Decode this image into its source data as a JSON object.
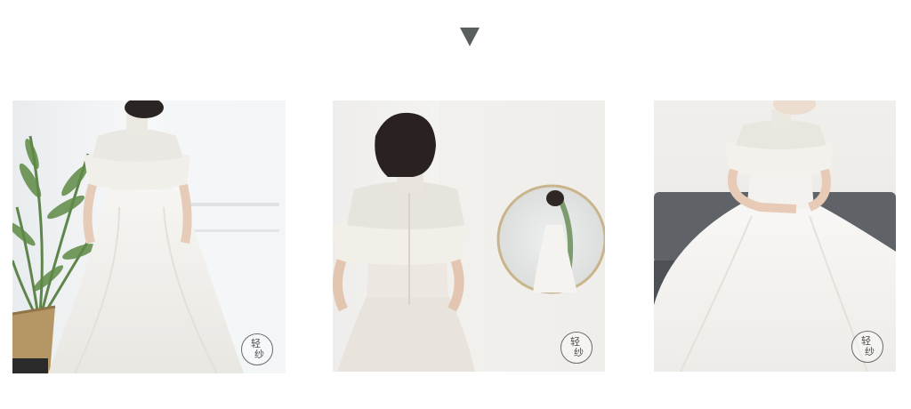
{
  "indicator": {
    "icon": "down-triangle-icon",
    "color": "#5a5e5e"
  },
  "gallery": {
    "photos": [
      {
        "subject": "wedding-dress-back-view-with-palm-plant",
        "watermark_line1": "轻",
        "watermark_line2": "纱"
      },
      {
        "subject": "wedding-dress-back-view-with-round-mirror",
        "watermark_line1": "轻",
        "watermark_line2": "纱"
      },
      {
        "subject": "wedding-dress-front-view-on-sofa",
        "watermark_line1": "轻",
        "watermark_line2": "纱"
      }
    ]
  }
}
